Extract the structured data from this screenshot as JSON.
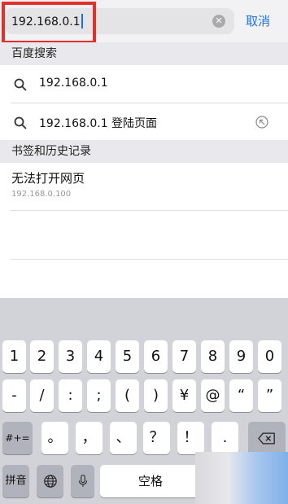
{
  "search": {
    "value": "192.168.0.1",
    "cancel_label": "取消"
  },
  "sections": {
    "baidu": "百度搜索",
    "bookmarks": "书签和历史记录"
  },
  "suggestions": [
    {
      "text": "192.168.0.1"
    },
    {
      "text": "192.168.0.1 登陆页面"
    }
  ],
  "history": [
    {
      "title": "无法打开网页",
      "url": "192.168.0.100"
    }
  ],
  "keyboard": {
    "row1": [
      "1",
      "2",
      "3",
      "4",
      "5",
      "6",
      "7",
      "8",
      "9",
      "0"
    ],
    "row2": [
      "-",
      "/",
      ":",
      ";",
      "(",
      ")",
      "¥",
      "@",
      "“",
      "”"
    ],
    "row3_left": "#+=",
    "row3": [
      "。",
      "，",
      "、",
      "？",
      "！",
      "."
    ],
    "bottom": {
      "pinyin": "拼音",
      "space": "空格"
    }
  },
  "icons": [
    "search-icon",
    "clear-icon",
    "arrow-up-left-icon",
    "backspace-icon",
    "globe-icon",
    "microphone-icon"
  ],
  "colors": {
    "accent": "#1a73e8",
    "highlight": "#e2302b"
  }
}
